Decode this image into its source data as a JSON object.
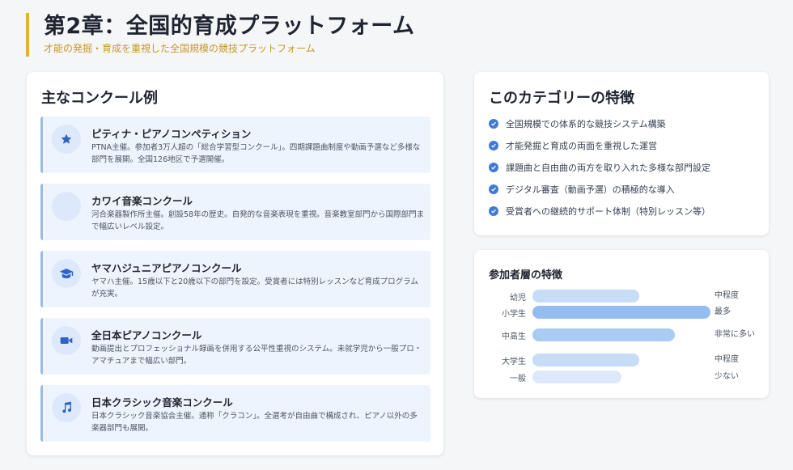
{
  "header": {
    "title": "第2章：全国的育成プラットフォーム",
    "subtitle": "才能の発掘・育成を重視した全国規模の競技プラットフォーム"
  },
  "competitions": {
    "heading": "主なコンクール例",
    "items": [
      {
        "name": "ピティナ・ピアノコンペティション",
        "desc": "PTNA主催。参加者3万人超の「総合学習型コンクール」。四期課題曲制度や動画予選など多様な部門を展開。全国126地区で予選開催。",
        "icon": "star-icon"
      },
      {
        "name": "カワイ音楽コンクール",
        "desc": "河合楽器製作所主催。創設58年の歴史。自発的な音楽表現を重視。音楽教室部門から国際部門まで幅広いレベル設定。",
        "icon": "none"
      },
      {
        "name": "ヤマハジュニアピアノコンクール",
        "desc": "ヤマハ主催。15歳以下と20歳以下の部門を設定。受賞者には特別レッスンなど育成プログラムが充実。",
        "icon": "graduation-cap-icon"
      },
      {
        "name": "全日本ピアノコンクール",
        "desc": "動画提出とプロフェッショナル録画を併用する公平性重視のシステム。未就学児から一般プロ・アマチュアまで幅広い部門。",
        "icon": "video-camera-icon"
      },
      {
        "name": "日本クラシック音楽コンクール",
        "desc": "日本クラシック音楽協会主催。通称「クラコン」。全選考が自由曲で構成され、ピアノ以外の多楽器部門も展開。",
        "icon": "music-note-icon"
      }
    ]
  },
  "features": {
    "heading": "このカテゴリーの特徴",
    "items": [
      "全国規模での体系的な競技システム構築",
      "才能発掘と育成の両面を重視した運営",
      "課題曲と自由曲の両方を取り入れた多様な部門設定",
      "デジタル審査（動画予選）の積極的な導入",
      "受賞者への継続的サポート体制（特別レッスン等）"
    ]
  },
  "participants": {
    "heading": "参加者層の特徴",
    "chart_data": {
      "type": "bar",
      "orientation": "horizontal",
      "categories": [
        "幼児",
        "小学生",
        "中高生",
        "大学生",
        "一般"
      ],
      "values": [
        0.6,
        1.0,
        0.8,
        0.6,
        0.5
      ],
      "value_labels": [
        "中程度",
        "最多",
        "非常に多い",
        "中程度",
        "少ない"
      ],
      "colors": [
        "#c7dcf7",
        "#93bdf1",
        "#a9cbf4",
        "#c7dcf7",
        "#dde9fb"
      ]
    }
  }
}
